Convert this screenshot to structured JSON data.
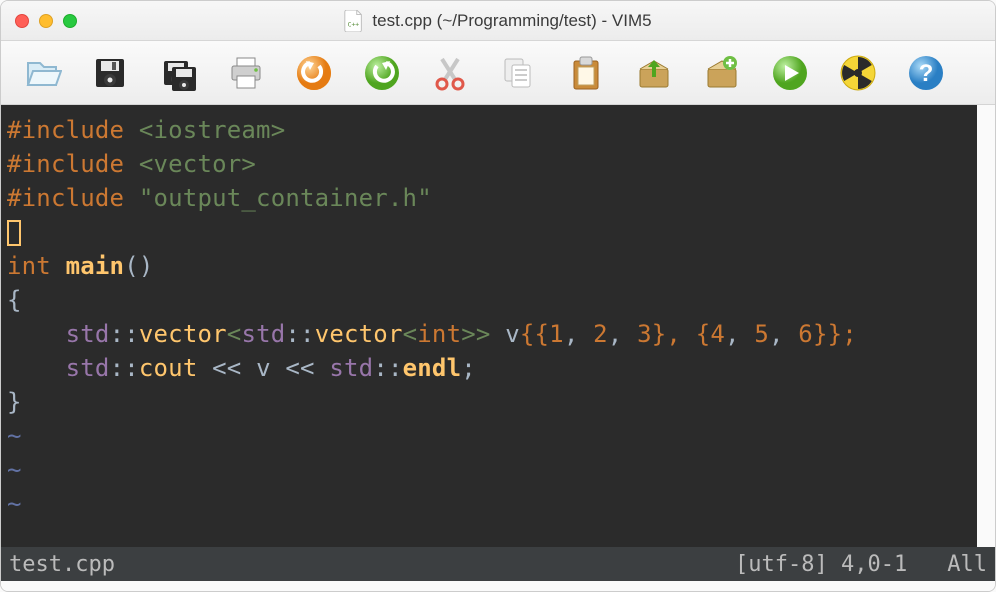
{
  "window": {
    "title": "test.cpp (~/Programming/test) - VIM5",
    "filetype_icon": "cpp-file-icon"
  },
  "toolbar": {
    "open_label": "Open",
    "save_label": "Save",
    "saveall_label": "Save All",
    "print_label": "Print",
    "undo_label": "Undo",
    "redo_label": "Redo",
    "cut_label": "Cut",
    "copy_label": "Copy",
    "paste_label": "Paste",
    "export_label": "Upload",
    "new_label": "New",
    "run_label": "Run",
    "build_label": "Radiation",
    "help_label": "Help"
  },
  "code": {
    "l1": {
      "directive": "#include",
      "arg": "<iostream>"
    },
    "l2": {
      "directive": "#include",
      "arg": "<vector>"
    },
    "l3": {
      "directive": "#include",
      "arg": "\"output_container.h\""
    },
    "l5": {
      "kw": "int",
      "fn": "main",
      "paren": "()"
    },
    "l6": {
      "brace": "{"
    },
    "l7": {
      "indent": "    ",
      "ns1": "std",
      "co1": "::",
      "id1": "vector",
      "a1": "<",
      "ns2": "std",
      "co2": "::",
      "id2": "vector",
      "a2": "<",
      "type": "int",
      "a3": ">>",
      "sp": " ",
      "var": "v",
      "init": "{{",
      "n1": "1",
      "c1": ", ",
      "n2": "2",
      "c2": ", ",
      "n3": "3",
      "mid": "}, {",
      "n4": "4",
      "c3": ", ",
      "n5": "5",
      "c4": ", ",
      "n6": "6",
      "end": "}};"
    },
    "l8": {
      "indent": "    ",
      "ns1": "std",
      "co1": "::",
      "id1": "cout",
      "op1": " << ",
      "var": "v",
      "op2": " << ",
      "ns2": "std",
      "co2": "::",
      "id2": "endl",
      "semi": ";"
    },
    "l9": {
      "brace": "}"
    },
    "tilde": "~"
  },
  "status": {
    "filename": "test.cpp",
    "encoding": "[utf-8]",
    "position": "4,0-1",
    "scroll": "All"
  }
}
